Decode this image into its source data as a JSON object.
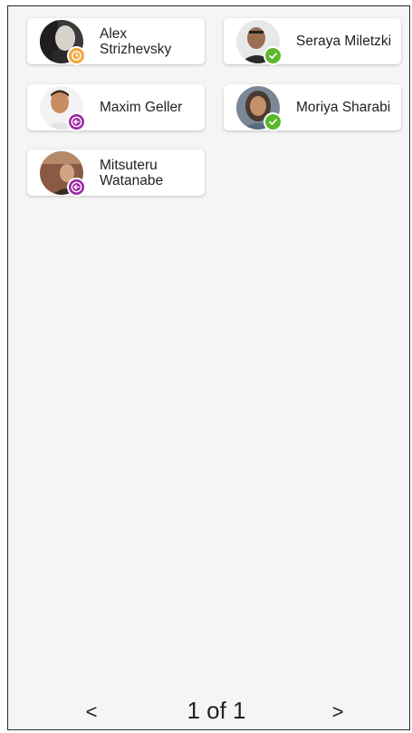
{
  "colors": {
    "badge_pending": "#f5a53a",
    "badge_approved": "#5cb82b",
    "badge_returning": "#9c27a8",
    "card_bg": "#ffffff",
    "panel_bg": "#f5f5f5"
  },
  "people": [
    {
      "name": "Alex\nStrizhevsky",
      "status": "pending",
      "status_icon": "clock-icon"
    },
    {
      "name": "Seraya Miletzki",
      "status": "approved",
      "status_icon": "check-icon"
    },
    {
      "name": "Maxim Geller",
      "status": "returning",
      "status_icon": "arrow-left-icon"
    },
    {
      "name": "Moriya Sharabi",
      "status": "approved",
      "status_icon": "check-icon"
    },
    {
      "name": "Mitsuteru\nWatanabe",
      "status": "returning",
      "status_icon": "arrow-left-icon"
    }
  ],
  "pagination": {
    "prev_label": "<",
    "status": "1 of 1",
    "next_label": ">"
  }
}
